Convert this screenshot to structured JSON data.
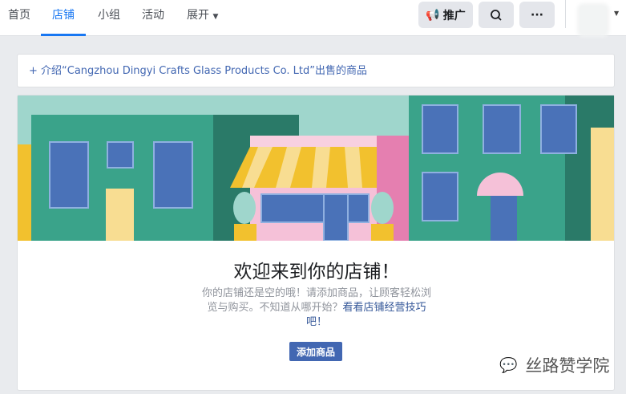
{
  "nav": {
    "tabs": [
      "首页",
      "店铺",
      "小组",
      "活动",
      "展开"
    ],
    "active": 1,
    "promote": "推广"
  },
  "intro": {
    "text": "介绍“Cangzhou Dingyi Crafts Glass Products Co. Ltd”出售的商品"
  },
  "shop": {
    "title": "欢迎来到你的店铺！",
    "desc": "你的店铺还是空的哦！请添加商品，让顾客轻松浏览与购买。不知道从哪开始？",
    "link": "看看店铺经营技巧吧！",
    "add_button": "添加商品"
  },
  "watermark": "丝路赞学院",
  "colors": {
    "accent": "#1877f2",
    "button": "#4267b2"
  }
}
